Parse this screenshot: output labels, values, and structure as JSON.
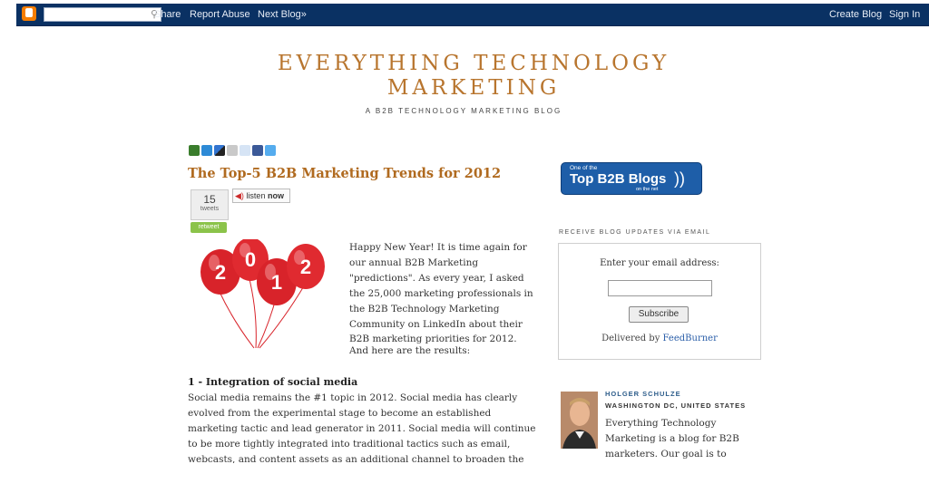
{
  "navbar": {
    "share": "Share",
    "report_abuse": "Report Abuse",
    "next_blog": "Next Blog»",
    "create_blog": "Create Blog",
    "sign_in": "Sign In",
    "search_value": ""
  },
  "header": {
    "title_line1": "EVERYTHING TECHNOLOGY",
    "title_line2": "MARKETING",
    "description": "A B2B TECHNOLOGY MARKETING BLOG"
  },
  "post": {
    "title": "The Top-5 B2B Marketing Trends for 2012",
    "tweet_count": "15",
    "tweet_label": "tweets",
    "retweet_label": "retweet",
    "listen_label": "listen",
    "listen_now": "now",
    "intro": "Happy New Year! It is time again for our annual B2B Marketing \"predictions\". As every year, I asked the 25,000 marketing professionals in the B2B Technology Marketing Community on LinkedIn about their B2B marketing priorities for 2012.",
    "results_line": "And here are the results:",
    "section1_heading": "1 - Integration of social media",
    "section1_body": "Social media remains the #1 topic in 2012. Social media has clearly evolved from the experimental stage to become an established marketing tactic and lead generator in 2011. Social media will continue to be more tightly integrated into traditional tactics such as email, webcasts, and content assets as an additional channel to broaden the reach of marketing messages and",
    "balloon_digits": [
      "2",
      "0",
      "1",
      "2"
    ]
  },
  "sidebar": {
    "badge_small": "One of the",
    "badge_big": "Top B2B Blogs",
    "badge_net": "on the net",
    "email_heading": "RECEIVE BLOG UPDATES VIA EMAIL",
    "email_label": "Enter your email address:",
    "email_value": "",
    "subscribe_label": "Subscribe",
    "delivered_by": "Delivered by",
    "feedburner": "FeedBurner",
    "author_name": "HOLGER SCHULZE",
    "author_location": "WASHINGTON DC, UNITED STATES",
    "author_bio": "Everything Technology Marketing is a blog for B2B marketers. Our goal is to educate on new trends,"
  },
  "colors": {
    "navbar_bg": "#0a3163",
    "title_color": "#b8752e",
    "post_title_color": "#b06a1f",
    "badge_bg": "#1e5ea8",
    "balloon_red": "#d8232a"
  }
}
